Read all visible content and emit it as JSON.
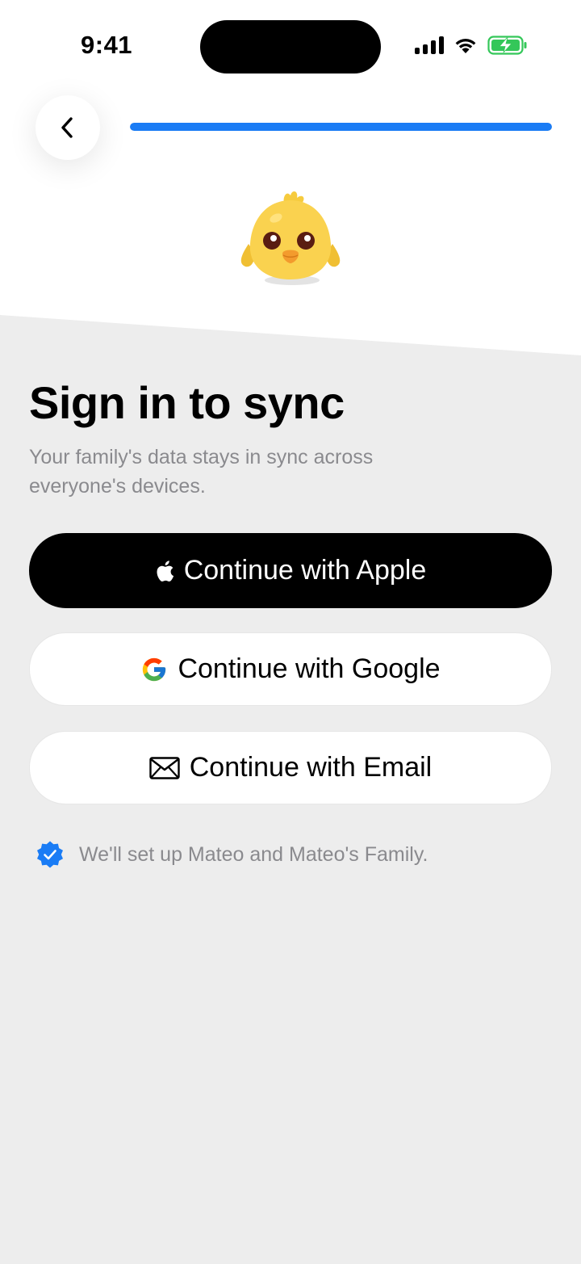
{
  "status_bar": {
    "time": "9:41",
    "icons": [
      "signal-icon",
      "wifi-icon",
      "battery-charging-icon"
    ],
    "battery_color": "#34c759"
  },
  "nav": {
    "back_icon": "chevron-left-icon",
    "progress": 1.0,
    "progress_color": "#1a7cf5"
  },
  "mascot": {
    "icon": "chick-mascot-icon"
  },
  "content": {
    "title": "Sign in to sync",
    "subtitle": "Your family's data stays in sync across everyone's devices."
  },
  "buttons": {
    "apple_label": "Continue with Apple",
    "google_label": "Continue with Google",
    "email_label": "Continue with Email"
  },
  "note": {
    "text": "We'll set up Mateo and Mateo's Family.",
    "icon": "verified-badge-icon",
    "icon_color": "#1a7cf5"
  },
  "colors": {
    "background_top": "#ffffff",
    "background_bottom": "#ededed",
    "accent": "#1a7cf5"
  }
}
